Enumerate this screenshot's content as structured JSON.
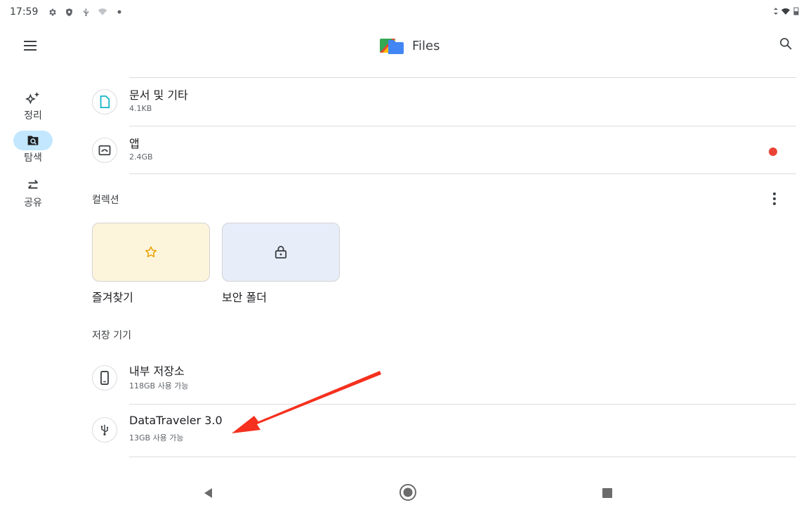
{
  "status_bar": {
    "time": "17:59"
  },
  "app": {
    "title": "Files"
  },
  "nav_rail": [
    {
      "label": "정리",
      "icon": "sparkle-icon"
    },
    {
      "label": "탐색",
      "icon": "folder-search-icon",
      "active": true
    },
    {
      "label": "공유",
      "icon": "swap-icon"
    }
  ],
  "categories": [
    {
      "title": "문서 및 기타",
      "size": "4.1KB",
      "icon": "document-icon"
    },
    {
      "title": "앱",
      "size": "2.4GB",
      "icon": "android-app-icon",
      "has_badge": true
    }
  ],
  "collections": {
    "heading": "컬렉션",
    "items": [
      {
        "label": "즐겨찾기",
        "icon": "star-icon",
        "color": "#fdf4dc"
      },
      {
        "label": "보안 폴더",
        "icon": "lock-icon",
        "color": "#e8edfa"
      }
    ]
  },
  "storage": {
    "heading": "저장 기기",
    "items": [
      {
        "title": "내부 저장소",
        "subtitle": "118GB 사용 가능",
        "icon": "phone-icon"
      },
      {
        "title": "DataTraveler 3.0",
        "subtitle": "13GB 사용 가능",
        "icon": "usb-icon"
      }
    ]
  },
  "colors": {
    "accent": "#c2e7ff",
    "badge": "#ea4335",
    "annotation_arrow": "#f5301e"
  }
}
